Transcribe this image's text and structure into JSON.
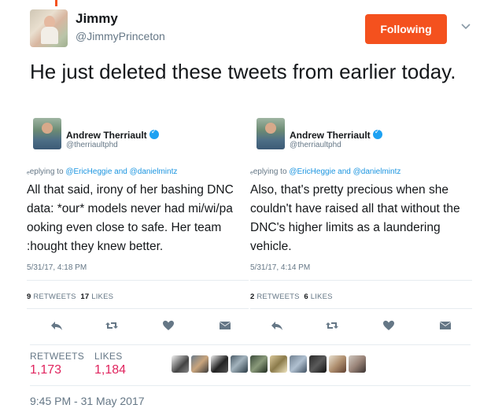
{
  "author": {
    "name": "Jimmy",
    "handle": "@JimmyPrinceton",
    "follow_label": "Following"
  },
  "tweet": {
    "text": "He just deleted these tweets from earlier today."
  },
  "media": [
    {
      "name": "Andrew Therriault",
      "handle": "@therriaultphd",
      "reply_prefix": "ₑeplying to",
      "reply_to": "@EricHeggie and @danielmintz",
      "lines": [
        "All that said, irony of her bashing DNC",
        "data: *our* models never had mi/wi/pa",
        "ooking even close to safe. Her team",
        ":hought they knew better."
      ],
      "time": "5/31/17, 4:18 PM",
      "retweets": "9",
      "retweets_label": "RETWEETS",
      "likes": "17",
      "likes_label": "LIKES"
    },
    {
      "name": "Andrew Therriault",
      "handle": "@therriaultphd",
      "reply_prefix": "ₑeplying to",
      "reply_to": "@EricHeggie and @danielmintz",
      "lines": [
        "Also, that's pretty precious when she",
        "couldn't have raised all that without the",
        "DNC's higher limits as a laundering",
        "vehicle."
      ],
      "time": "5/31/17, 4:14 PM",
      "retweets": "2",
      "retweets_label": "RETWEETS",
      "likes": "6",
      "likes_label": "LIKES"
    }
  ],
  "stats": {
    "retweets_label": "RETWEETS",
    "retweets": "1,173",
    "likes_label": "LIKES",
    "likes": "1,184"
  },
  "likers": [
    "liker-1",
    "liker-2",
    "liker-3",
    "liker-4",
    "liker-5",
    "liker-6",
    "liker-7",
    "liker-8",
    "liker-9",
    "liker-10"
  ],
  "timestamp": "9:45 PM - 31 May 2017",
  "colors": {
    "follow": "#f4511e",
    "likes": "#e0245e",
    "muted": "#657786",
    "link": "#1b95e0"
  },
  "icons": [
    "reply-icon",
    "retweet-icon",
    "like-icon",
    "message-icon",
    "chevron-down-icon",
    "verified-icon"
  ]
}
